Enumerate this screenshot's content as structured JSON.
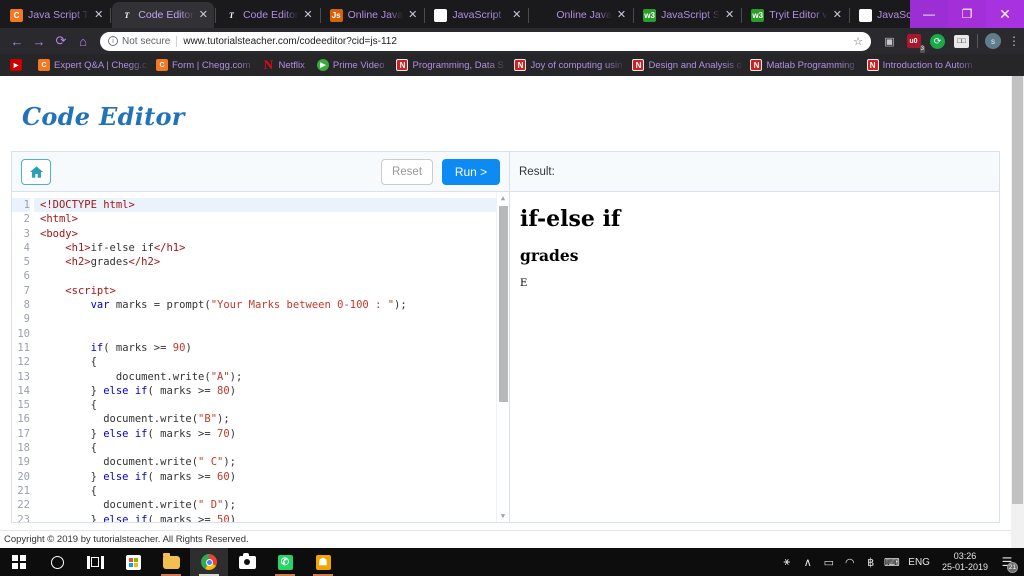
{
  "browser": {
    "tabs": [
      {
        "label": "Java Script T",
        "favicon": "chegg-icon",
        "active": false
      },
      {
        "label": "Code Editor",
        "favicon": "tutorialsteacher-icon",
        "active": true
      },
      {
        "label": "Code Editor",
        "favicon": "tutorialsteacher-icon",
        "active": false
      },
      {
        "label": "Online Java",
        "favicon": "js-icon",
        "active": false
      },
      {
        "label": "JavaScript :",
        "favicon": "w3-red-icon",
        "active": false
      },
      {
        "label": "Online Java",
        "favicon": "code-brackets-icon",
        "active": false
      },
      {
        "label": "JavaScript S",
        "favicon": "w3schools-icon",
        "active": false
      },
      {
        "label": "Tryit Editor v",
        "favicon": "w3schools-icon",
        "active": false
      },
      {
        "label": "JavaScript N",
        "favicon": "w3-red-icon",
        "active": false
      }
    ],
    "new_tab_label": "+",
    "close_label": "✕",
    "window_controls": {
      "minimize": "—",
      "maximize": "❐",
      "close": "✕"
    },
    "nav": {
      "back": "←",
      "forward": "→",
      "reload": "⟳",
      "home": "⌂"
    },
    "omnibox": {
      "security_label": "Not secure",
      "info_glyph": "i",
      "url": "www.tutorialsteacher.com/codeeditor?cid=js-112",
      "star": "☆"
    },
    "extensions": [
      {
        "name": "camera-icon",
        "glyph": "▣"
      },
      {
        "name": "ublock-icon",
        "glyph": "u0",
        "badge": "3"
      },
      {
        "name": "green-circle-icon",
        "glyph": "⟳"
      },
      {
        "name": "reader-icon",
        "glyph": "□□"
      },
      {
        "name": "profile-avatar",
        "glyph": "s"
      }
    ],
    "menu_glyph": "⋮",
    "bookmarks": [
      {
        "label": "",
        "icon": "youtube-icon"
      },
      {
        "label": "Expert Q&A | Chegg.c",
        "icon": "chegg-icon"
      },
      {
        "label": "Form | Chegg.com",
        "icon": "chegg-icon"
      },
      {
        "label": "Netflix",
        "icon": "netflix-icon"
      },
      {
        "label": "Prime Video",
        "icon": "prime-video-icon"
      },
      {
        "label": "Programming, Data S",
        "icon": "nptel-icon"
      },
      {
        "label": "Joy of computing usin",
        "icon": "nptel-icon"
      },
      {
        "label": "Design and Analysis o",
        "icon": "nptel-icon"
      },
      {
        "label": "Matlab Programming",
        "icon": "nptel-icon"
      },
      {
        "label": "Introduction to Autom",
        "icon": "nptel-icon"
      }
    ]
  },
  "page": {
    "site_title": "Code Editor",
    "toolbar": {
      "home_icon": "🏠",
      "reset_label": "Reset",
      "run_label": "Run >"
    },
    "result": {
      "header_label": "Result:",
      "h1": "if-else if",
      "h2": "grades",
      "output": "E"
    },
    "footer": "Copyright © 2019 by tutorialsteacher. All Rights Reserved.",
    "code": {
      "first_line_number": 1,
      "lines": [
        [
          {
            "t": "<!DOCTYPE html>",
            "c": "tag"
          }
        ],
        [
          {
            "t": "<html>",
            "c": "tag"
          }
        ],
        [
          {
            "t": "<body>",
            "c": "tag"
          }
        ],
        [
          {
            "t": "    ",
            "c": "plain"
          },
          {
            "t": "<h1>",
            "c": "tag"
          },
          {
            "t": "if-else if",
            "c": "plain"
          },
          {
            "t": "</h1>",
            "c": "tag"
          }
        ],
        [
          {
            "t": "    ",
            "c": "plain"
          },
          {
            "t": "<h2>",
            "c": "tag"
          },
          {
            "t": "grades",
            "c": "plain"
          },
          {
            "t": "</h2>",
            "c": "tag"
          }
        ],
        [],
        [
          {
            "t": "    ",
            "c": "plain"
          },
          {
            "t": "<script>",
            "c": "tag"
          }
        ],
        [
          {
            "t": "        ",
            "c": "plain"
          },
          {
            "t": "var",
            "c": "kw"
          },
          {
            "t": " marks = prompt(",
            "c": "plain"
          },
          {
            "t": "\"Your Marks between 0-100 : \"",
            "c": "str"
          },
          {
            "t": ");",
            "c": "plain"
          }
        ],
        [],
        [],
        [
          {
            "t": "        ",
            "c": "plain"
          },
          {
            "t": "if",
            "c": "kw"
          },
          {
            "t": "( marks >= ",
            "c": "plain"
          },
          {
            "t": "90",
            "c": "num"
          },
          {
            "t": ")",
            "c": "plain"
          }
        ],
        [
          {
            "t": "        {",
            "c": "plain"
          }
        ],
        [
          {
            "t": "            document.write(",
            "c": "plain"
          },
          {
            "t": "\"A\"",
            "c": "str"
          },
          {
            "t": ");",
            "c": "plain"
          }
        ],
        [
          {
            "t": "        } ",
            "c": "plain"
          },
          {
            "t": "else if",
            "c": "kw"
          },
          {
            "t": "( marks >= ",
            "c": "plain"
          },
          {
            "t": "80",
            "c": "num"
          },
          {
            "t": ")",
            "c": "plain"
          }
        ],
        [
          {
            "t": "        {",
            "c": "plain"
          }
        ],
        [
          {
            "t": "          document.write(",
            "c": "plain"
          },
          {
            "t": "\"B\"",
            "c": "str"
          },
          {
            "t": ");",
            "c": "plain"
          }
        ],
        [
          {
            "t": "        } ",
            "c": "plain"
          },
          {
            "t": "else if",
            "c": "kw"
          },
          {
            "t": "( marks >= ",
            "c": "plain"
          },
          {
            "t": "70",
            "c": "num"
          },
          {
            "t": ")",
            "c": "plain"
          }
        ],
        [
          {
            "t": "        {",
            "c": "plain"
          }
        ],
        [
          {
            "t": "          document.write(",
            "c": "plain"
          },
          {
            "t": "\" C\"",
            "c": "str"
          },
          {
            "t": ");",
            "c": "plain"
          }
        ],
        [
          {
            "t": "        } ",
            "c": "plain"
          },
          {
            "t": "else if",
            "c": "kw"
          },
          {
            "t": "( marks >= ",
            "c": "plain"
          },
          {
            "t": "60",
            "c": "num"
          },
          {
            "t": ")",
            "c": "plain"
          }
        ],
        [
          {
            "t": "        {",
            "c": "plain"
          }
        ],
        [
          {
            "t": "          document.write(",
            "c": "plain"
          },
          {
            "t": "\" D\"",
            "c": "str"
          },
          {
            "t": ");",
            "c": "plain"
          }
        ],
        [
          {
            "t": "        } ",
            "c": "plain"
          },
          {
            "t": "else if",
            "c": "kw"
          },
          {
            "t": "( marks >= ",
            "c": "plain"
          },
          {
            "t": "50",
            "c": "num"
          },
          {
            "t": ")",
            "c": "plain"
          }
        ],
        [
          {
            "t": "        {",
            "c": "plain"
          }
        ]
      ]
    }
  },
  "taskbar": {
    "items": [
      {
        "name": "start-button",
        "icon": "windows-logo-icon"
      },
      {
        "name": "cortana-button",
        "icon": "circle-icon"
      },
      {
        "name": "task-view-button",
        "icon": "task-view-icon"
      },
      {
        "name": "microsoft-store-button",
        "icon": "store-icon"
      },
      {
        "name": "file-explorer-button",
        "icon": "folder-icon"
      },
      {
        "name": "chrome-button",
        "icon": "chrome-icon"
      },
      {
        "name": "camera-button",
        "icon": "camera-icon"
      },
      {
        "name": "whatsapp-button",
        "icon": "whatsapp-icon"
      },
      {
        "name": "app-button",
        "icon": "orange-app-icon"
      }
    ],
    "tray": {
      "people_icon": "⚹",
      "chevron_icon": "∧",
      "battery_icon": "▭",
      "wifi_icon": "◠",
      "bluetooth_icon": "฿",
      "keyboard_icon": "⌨",
      "language": "ENG",
      "time": "03:26",
      "date": "25-01-2019",
      "notification_icon": "☰",
      "notification_count": "21"
    }
  },
  "colors": {
    "accent_blue": "#0d8bf2",
    "title_blue": "#2272b9",
    "teal": "#2aa0b5",
    "tab_purple": "#b18fe0",
    "win_purple": "#9b2fd4"
  }
}
